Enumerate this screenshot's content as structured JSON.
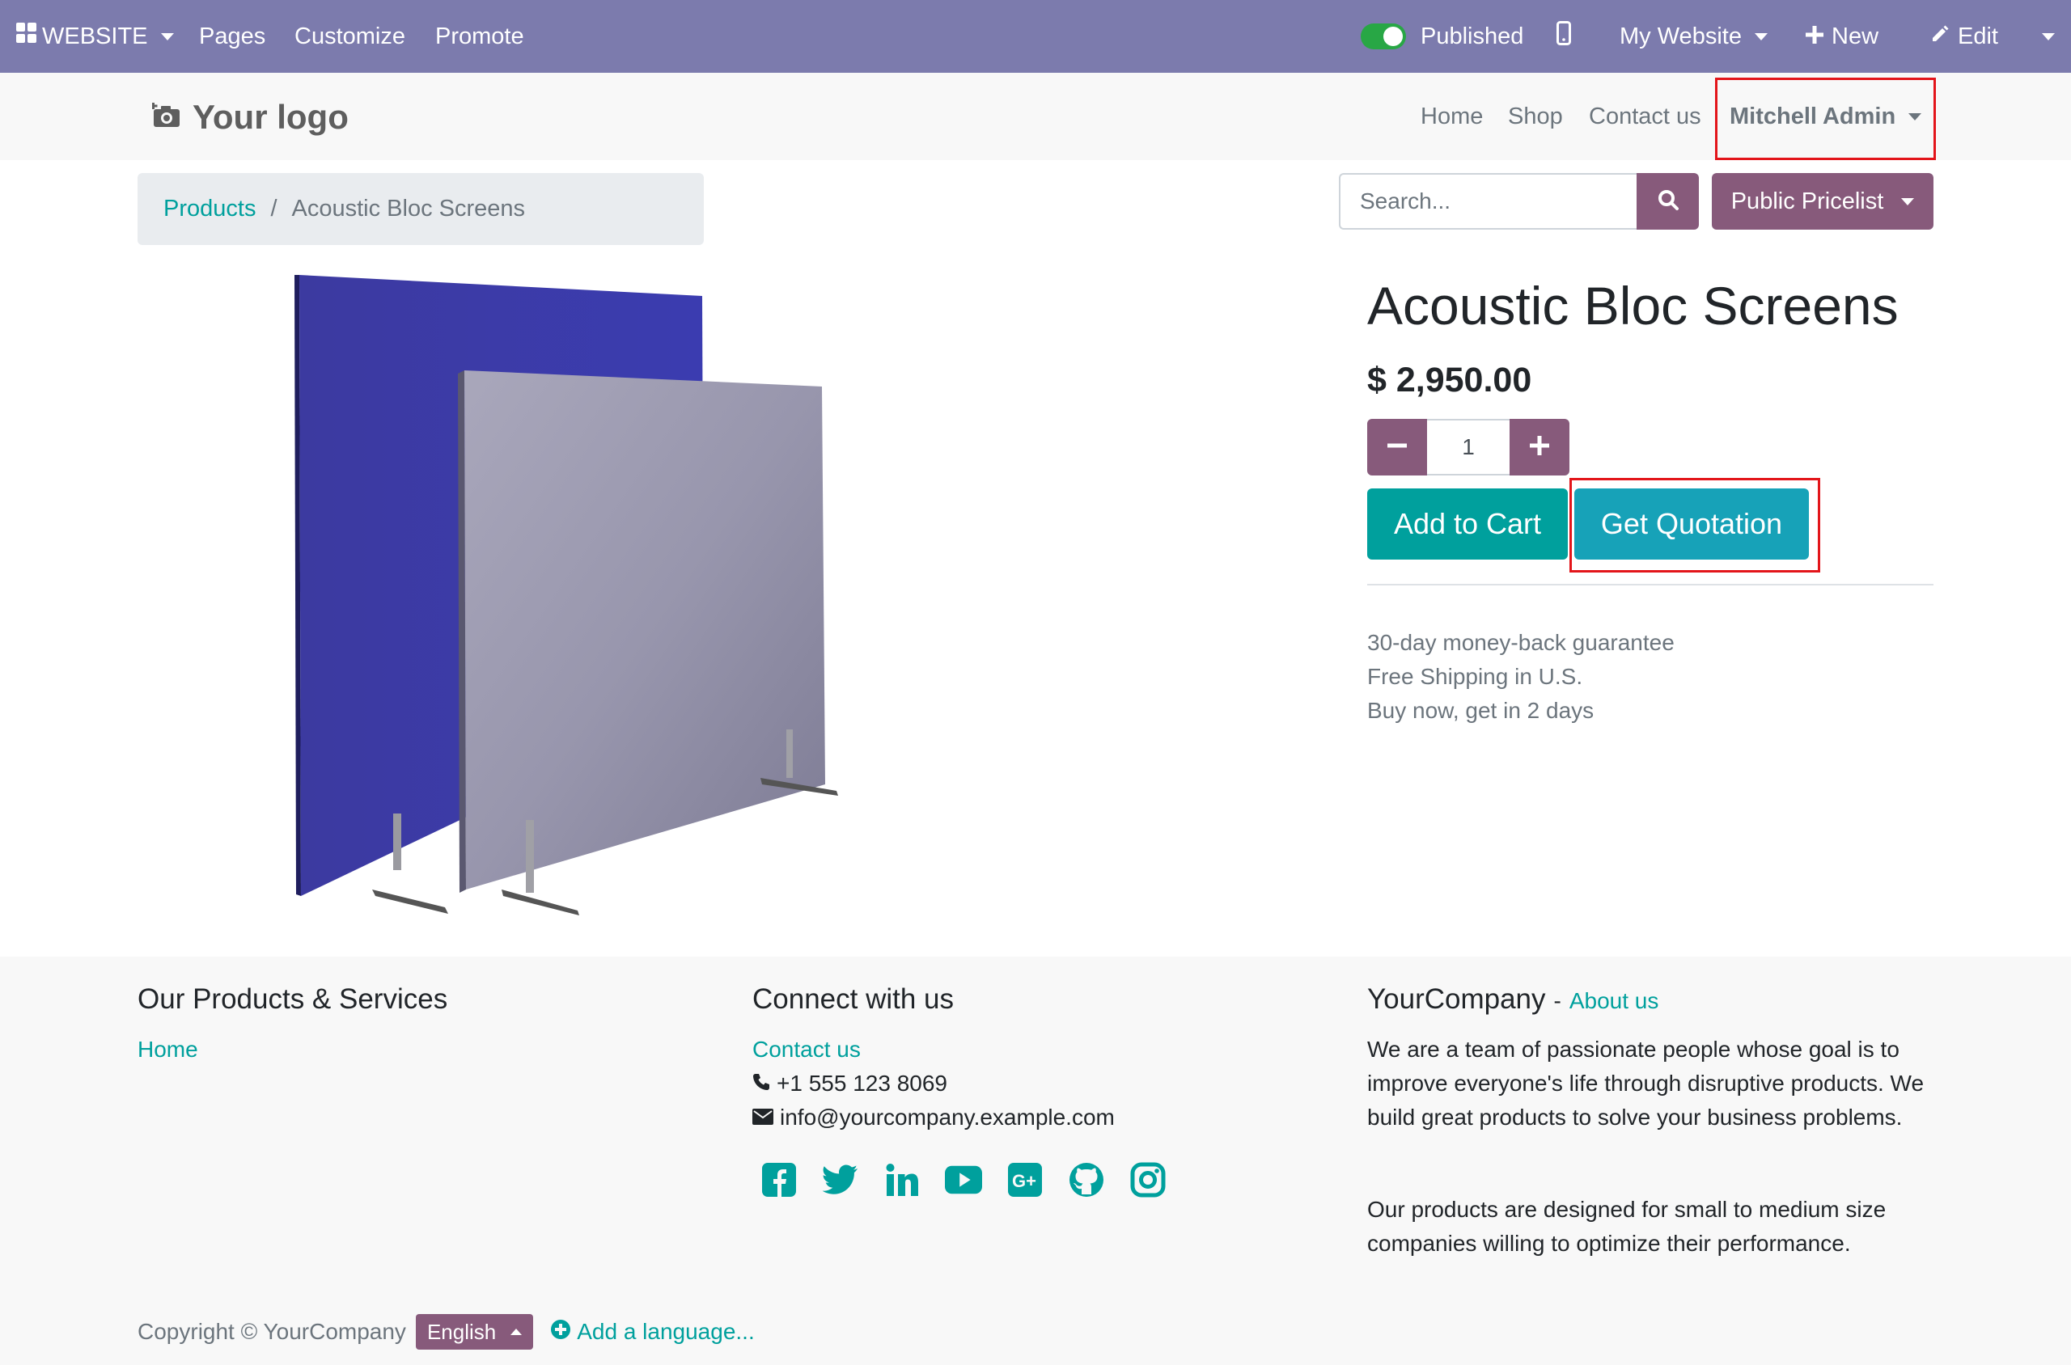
{
  "admin_bar": {
    "app_name": "WEBSITE",
    "menu": [
      "Pages",
      "Customize",
      "Promote"
    ],
    "published_label": "Published",
    "website_label": "My Website",
    "new_label": "New",
    "edit_label": "Edit"
  },
  "header": {
    "logo_text": "Your logo",
    "nav": [
      "Home",
      "Shop",
      "Contact us"
    ],
    "user_name": "Mitchell Admin"
  },
  "breadcrumb": {
    "parent": "Products",
    "separator": "/",
    "current": "Acoustic Bloc Screens"
  },
  "search": {
    "placeholder": "Search...",
    "pricelist_label": "Public Pricelist"
  },
  "product": {
    "name": "Acoustic Bloc Screens",
    "price": "$ 2,950.00",
    "quantity": "1",
    "add_to_cart_label": "Add to Cart",
    "get_quotation_label": "Get Quotation",
    "perks": [
      "30-day money-back guarantee",
      "Free Shipping in U.S.",
      "Buy now, get in 2 days"
    ]
  },
  "footer": {
    "col1": {
      "title": "Our Products & Services",
      "links": [
        "Home"
      ]
    },
    "col2": {
      "title": "Connect with us",
      "contact_link": "Contact us",
      "phone": "+1 555 123 8069",
      "email": "info@yourcompany.example.com",
      "social_icons": [
        "facebook-icon",
        "twitter-icon",
        "linkedin-icon",
        "youtube-icon",
        "google-plus-icon",
        "github-icon",
        "instagram-icon"
      ]
    },
    "col3": {
      "company": "YourCompany",
      "dash": "-",
      "about_link": "About us",
      "para1": "We are a team of passionate people whose goal is to improve everyone's life through disruptive products. We build great products to solve your business problems.",
      "para2": "Our products are designed for small to medium size companies willing to optimize their performance."
    },
    "copyright": "Copyright © YourCompany",
    "language": "English",
    "add_language": "Add a language..."
  },
  "colors": {
    "admin_bar": "#7c7bad",
    "primary": "#875a7b",
    "teal": "#00a09d",
    "info": "#17a2b8",
    "highlight": "#e3151a"
  }
}
